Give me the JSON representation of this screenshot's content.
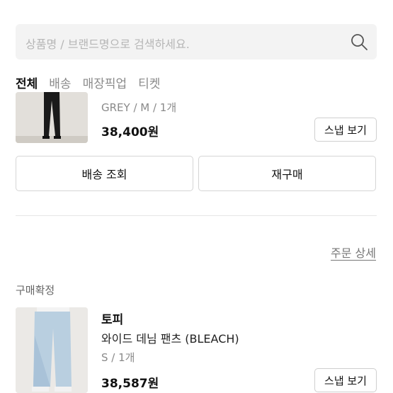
{
  "search": {
    "placeholder": "상품명 / 브랜드명으로 검색하세요."
  },
  "tabs": [
    {
      "label": "전체"
    },
    {
      "label": "배송"
    },
    {
      "label": "매장픽업"
    },
    {
      "label": "티켓"
    }
  ],
  "order1": {
    "option": "GREY / M / 1개",
    "price": "38,400원",
    "snap_label": "스냅 보기",
    "shipping_label": "배송 조회",
    "rebuy_label": "재구매"
  },
  "order_detail_link": "주문 상세",
  "order2": {
    "status": "구매확정",
    "brand": "토피",
    "product_name": "와이드 데님 팬츠 (BLEACH)",
    "option": "S / 1개",
    "price": "38,587원",
    "snap_label": "스냅 보기"
  }
}
